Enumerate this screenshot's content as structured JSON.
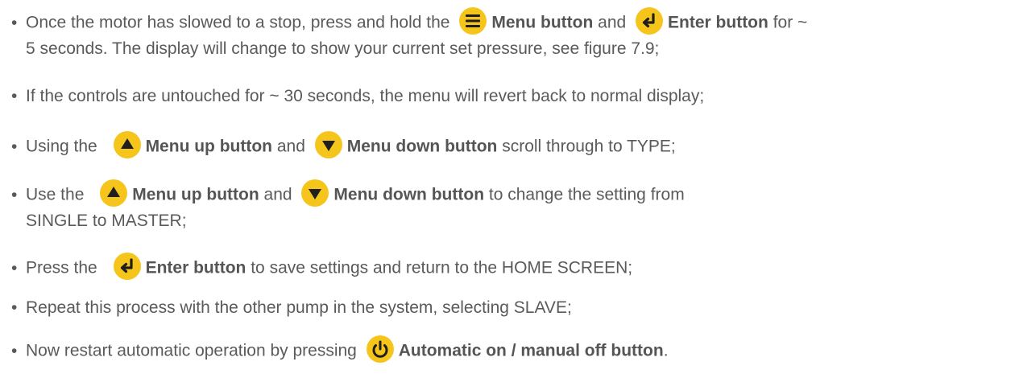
{
  "colors": {
    "text": "#5a5a5a",
    "button": "#f6c51c",
    "glyph": "#1f1f1f"
  },
  "icons": {
    "menu": "menu-icon",
    "enter": "enter-icon",
    "up": "menu-up-icon",
    "down": "menu-down-icon",
    "power": "power-icon"
  },
  "bullet": "•",
  "items": [
    {
      "a": "Once the motor has slowed to a stop, press and hold the",
      "b1": "Menu button",
      "c": "and",
      "b2": "Enter button",
      "d": "for ~",
      "e": "5 seconds. The display will change to show your current set pressure, see figure 7.9;"
    },
    {
      "a": "If the controls are untouched for ~ 30 seconds, the menu will revert back to normal display;"
    },
    {
      "a": "Using the",
      "b1": "Menu up button",
      "c": "and",
      "b2": "Menu down button",
      "d": "scroll through to TYPE;"
    },
    {
      "a": "Use the",
      "b1": "Menu up button",
      "c": "and",
      "b2": "Menu down button",
      "d": "to change the setting from",
      "e": "SINGLE to MASTER;"
    },
    {
      "a": "Press the",
      "b1": "Enter button",
      "d": "to save settings and return to the HOME SCREEN;"
    },
    {
      "a": "Repeat this process with the other pump in the system, selecting SLAVE;"
    },
    {
      "a": "Now restart automatic operation by pressing",
      "b1": "Automatic on / manual off button",
      "d": "."
    }
  ]
}
